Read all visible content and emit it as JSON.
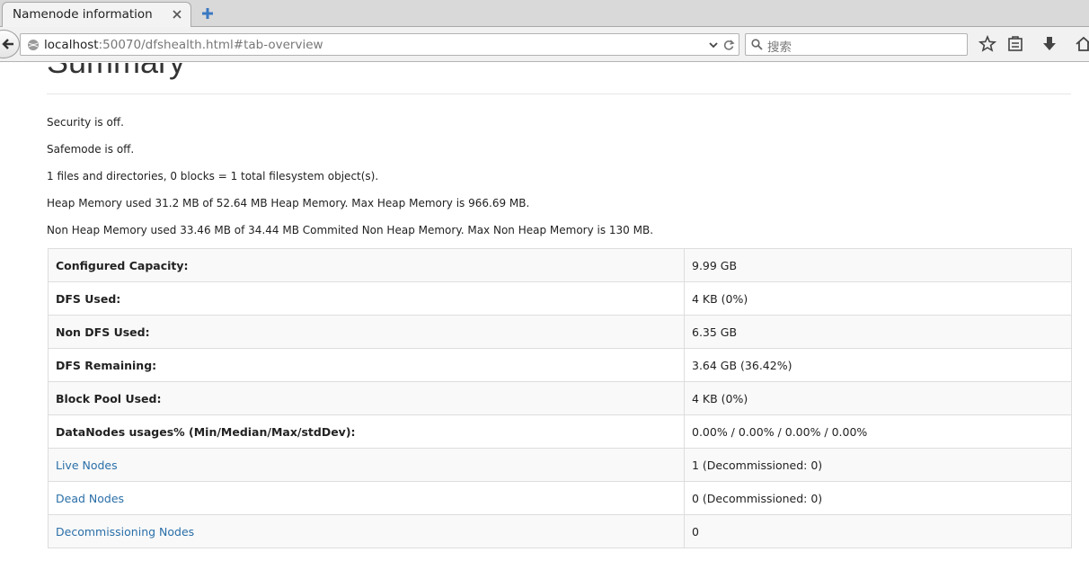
{
  "browser": {
    "tab_title": "Namenode information",
    "url_host": "localhost",
    "url_rest": ":50070/dfshealth.html#tab-overview",
    "search_placeholder": "搜索"
  },
  "page": {
    "heading": "Summary",
    "info_lines": [
      "Security is off.",
      "Safemode is off.",
      "1 files and directories, 0 blocks = 1 total filesystem object(s).",
      "Heap Memory used 31.2 MB of 52.64 MB Heap Memory. Max Heap Memory is 966.69 MB.",
      "Non Heap Memory used 33.46 MB of 34.44 MB Commited Non Heap Memory. Max Non Heap Memory is 130 MB."
    ],
    "rows": [
      {
        "label": "Configured Capacity:",
        "value": "9.99 GB"
      },
      {
        "label": "DFS Used:",
        "value": "4 KB (0%)"
      },
      {
        "label": "Non DFS Used:",
        "value": "6.35 GB"
      },
      {
        "label": "DFS Remaining:",
        "value": "3.64 GB (36.42%)"
      },
      {
        "label": "Block Pool Used:",
        "value": "4 KB (0%)"
      },
      {
        "label": "DataNodes usages% (Min/Median/Max/stdDev):",
        "value": "0.00% / 0.00% / 0.00% / 0.00%"
      },
      {
        "label": "Live Nodes",
        "value": "1 (Decommissioned: 0)"
      },
      {
        "label": "Dead Nodes",
        "value": "0 (Decommissioned: 0)"
      },
      {
        "label": "Decommissioning Nodes",
        "value": "0"
      }
    ]
  },
  "colors": {
    "link": "#2a6fa8",
    "row_stripe": "#f9f9f9",
    "border": "#dddddd"
  }
}
